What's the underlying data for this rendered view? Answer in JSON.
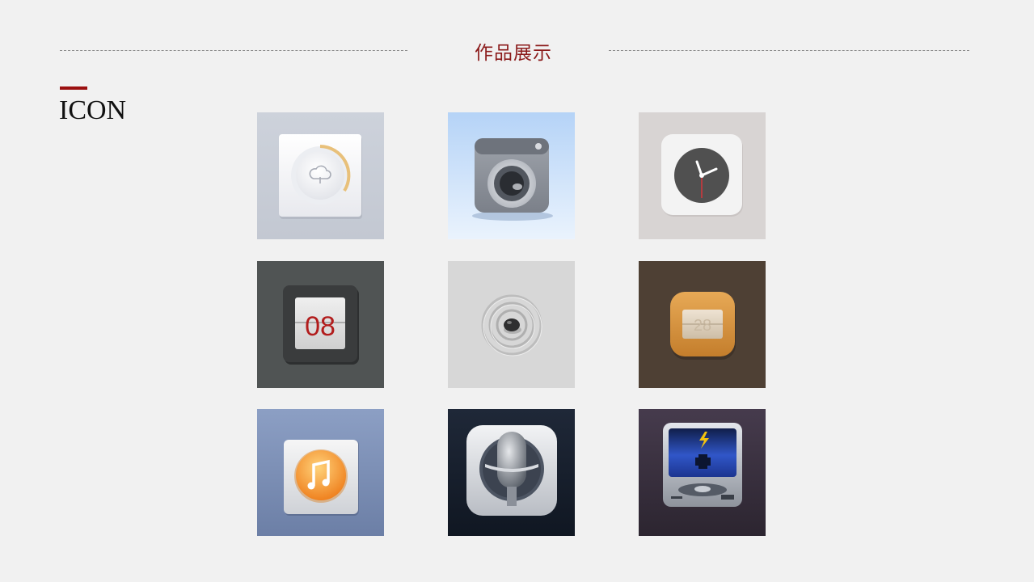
{
  "header": {
    "title": "作品展示"
  },
  "section": {
    "title": "ICON"
  },
  "icons": {
    "flip_clock_digits": "08",
    "calendar_day": "28"
  },
  "colors": {
    "accent": "#8b1a1a",
    "background": "#f1f1f1",
    "divider": "#8a8a8a"
  }
}
